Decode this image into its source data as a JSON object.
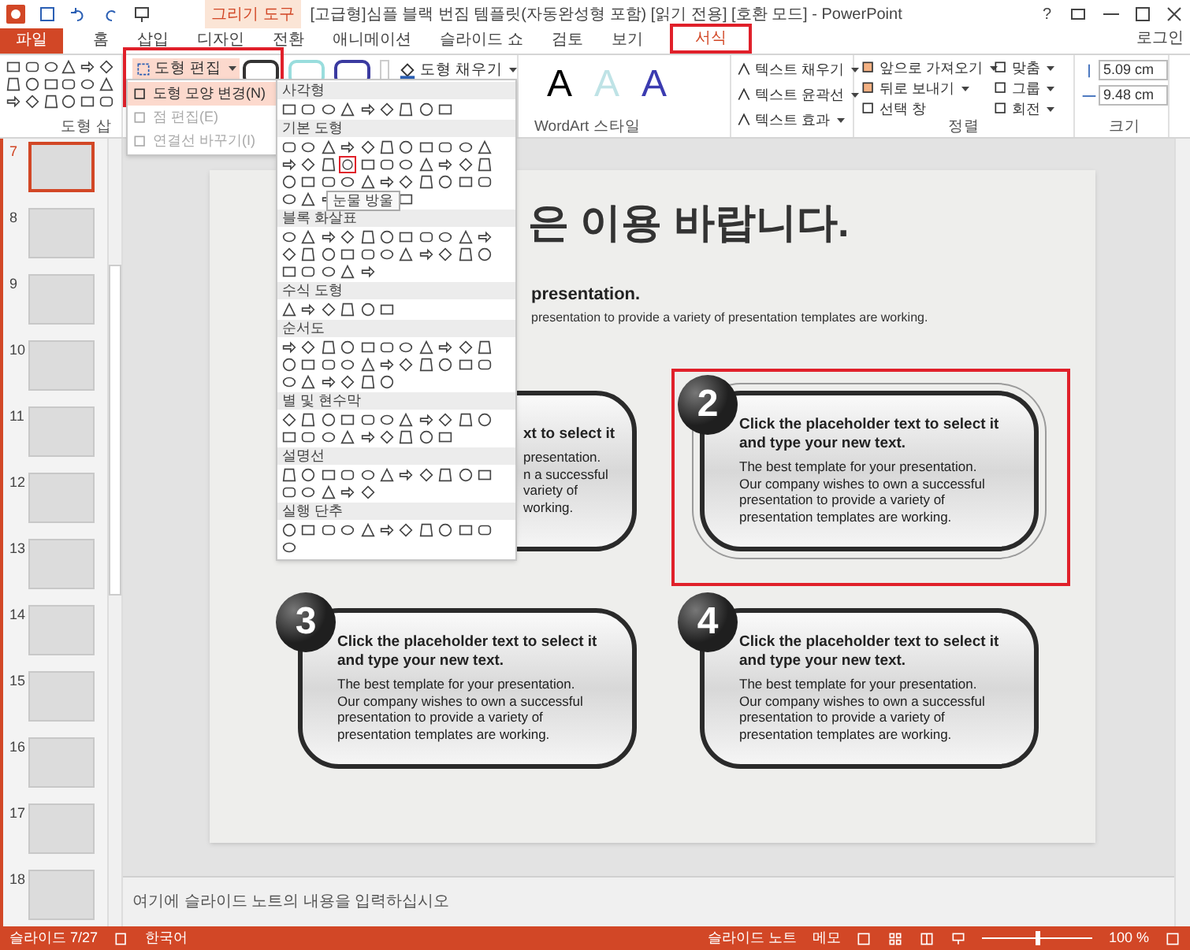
{
  "app": {
    "title": "[고급형]심플 블랙 번짐 템플릿(자동완성형 포함) [읽기 전용] [호환 모드] - PowerPoint",
    "context_group": "그리기 도구",
    "help": "?",
    "sign_in": "로그인"
  },
  "tabs": [
    {
      "label": "파일",
      "kind": "file",
      "selected": false
    },
    {
      "label": "홈",
      "kind": "tab",
      "selected": false
    },
    {
      "label": "삽입",
      "kind": "tab",
      "selected": false
    },
    {
      "label": "디자인",
      "kind": "tab",
      "selected": false
    },
    {
      "label": "전환",
      "kind": "tab",
      "selected": false
    },
    {
      "label": "애니메이션",
      "kind": "tab",
      "selected": false
    },
    {
      "label": "슬라이드 쇼",
      "kind": "tab",
      "selected": false
    },
    {
      "label": "검토",
      "kind": "tab",
      "selected": false
    },
    {
      "label": "보기",
      "kind": "tab",
      "selected": false
    },
    {
      "label": "서식",
      "kind": "context",
      "selected": true
    }
  ],
  "ribbon": {
    "insert_shapes": {
      "label": "도형 삽"
    },
    "edit_shape": {
      "label": "도형 편집"
    },
    "shape_fill": {
      "label": "도형 채우기"
    },
    "wordart": {
      "label": "WordArt 스타일",
      "samples": [
        "A",
        "A",
        "A"
      ],
      "commands": [
        "텍스트 채우기",
        "텍스트 윤곽선",
        "텍스트 효과"
      ]
    },
    "arrange": {
      "label": "정렬",
      "commands": [
        "앞으로 가져오기",
        "뒤로 보내기",
        "선택 창",
        "맞춤",
        "그룹",
        "회전"
      ]
    },
    "size": {
      "label": "크기",
      "height": "5.09 cm",
      "width": "9.48 cm"
    }
  },
  "edit_menu": {
    "items": [
      {
        "label": "도형 모양 변경(N)",
        "disabled": false,
        "selected": true
      },
      {
        "label": "점 편집(E)",
        "disabled": true,
        "selected": false
      },
      {
        "label": "연결선 바꾸기(I)",
        "disabled": true,
        "selected": false
      }
    ]
  },
  "shape_gallery": {
    "sections": [
      {
        "title": "사각형"
      },
      {
        "title": "기본 도형"
      },
      {
        "title": "블록 화살표"
      },
      {
        "title": "수식 도형"
      },
      {
        "title": "순서도"
      },
      {
        "title": "별 및 현수막"
      },
      {
        "title": "설명선"
      },
      {
        "title": "실행 단추"
      }
    ],
    "tooltip": "눈물 방울"
  },
  "thumbnails": [
    {
      "number": "7",
      "selected": true
    },
    {
      "number": "8",
      "selected": false
    },
    {
      "number": "9",
      "selected": false
    },
    {
      "number": "10",
      "selected": false
    },
    {
      "number": "11",
      "selected": false
    },
    {
      "number": "12",
      "selected": false
    },
    {
      "number": "13",
      "selected": false
    },
    {
      "number": "14",
      "selected": false
    },
    {
      "number": "15",
      "selected": false
    },
    {
      "number": "16",
      "selected": false
    },
    {
      "number": "17",
      "selected": false
    },
    {
      "number": "18",
      "selected": false
    }
  ],
  "slide": {
    "title": "은 이용 바랍니다.",
    "subheading": "presentation.",
    "subtitle": "presentation to provide a variety of presentation templates are working.",
    "cards": [
      {
        "kind": "covered",
        "heading": "xt to select it",
        "body_lines": [
          "presentation.",
          "n a successful",
          "variety of",
          "working."
        ],
        "selected": false
      },
      {
        "kind": "full",
        "number": "2",
        "heading": "Click the placeholder text to select it and type your new text.",
        "body_lines": [
          "The best template for your presentation.",
          "Our company wishes to own a successful",
          "presentation to provide a variety of",
          "presentation templates are working."
        ],
        "selected": true
      },
      {
        "kind": "full",
        "number": "3",
        "heading": "Click the placeholder text to select it and type your new text.",
        "body_lines": [
          "The best template for your presentation.",
          "Our company wishes to own a successful",
          "presentation to provide a variety of",
          "presentation templates are working."
        ],
        "selected": false
      },
      {
        "kind": "full",
        "number": "4",
        "heading": "Click the placeholder text to select it and type your new text.",
        "body_lines": [
          "The best template for your presentation.",
          "Our company wishes to own a successful",
          "presentation to provide a variety of",
          "presentation templates are working."
        ],
        "selected": false
      }
    ]
  },
  "notes": {
    "placeholder": "여기에 슬라이드 노트의 내용을 입력하십시오"
  },
  "status_bar": {
    "slide": "슬라이드 7/27",
    "language": "한국어",
    "notes": "슬라이드 노트",
    "comments": "메모",
    "zoom": {
      "level": 0.5
    },
    "zoom_reading": "100 %"
  }
}
